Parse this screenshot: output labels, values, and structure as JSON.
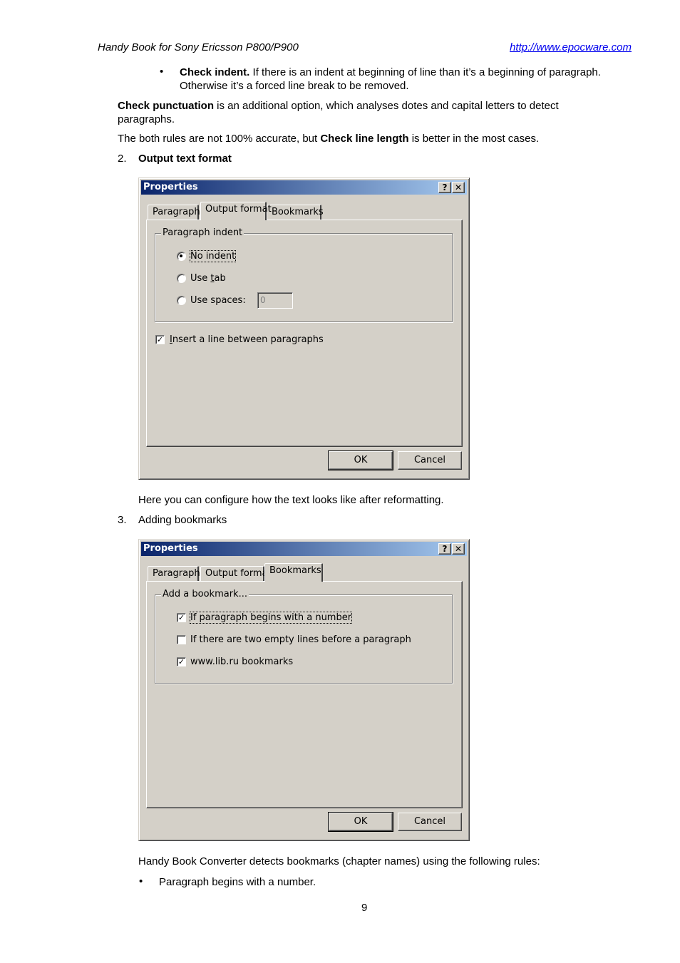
{
  "header": {
    "title": "Handy Book for Sony Ericsson P800/P900",
    "link": "http://www.epocware.com"
  },
  "text": {
    "bullet1_bold": "Check indent.",
    "bullet1_rest": " If there is an indent at beginning of line than it’s a beginning of paragraph.",
    "bullet1_line2": "Otherwise it’s a forced line break to be removed.",
    "p1_bold": "Check punctuation",
    "p1_rest": " is an additional option, which analyses dotes and capital letters to detect",
    "p1_line2": "paragraphs.",
    "p2_a": "The both rules are not 100% accurate, but ",
    "p2_bold": "Check line length",
    "p2_b": " is better in the most cases.",
    "item2_num": "2.",
    "item2_label": "Output text format",
    "after_dialog1": "Here you can configure how the text looks like after reformatting.",
    "item3_num": "3.",
    "item3_label": "Adding bookmarks",
    "after_dialog2": "Handy Book Converter detects bookmarks (chapter names) using the following rules:",
    "bullet_last": "Paragraph begins with a number.",
    "bullet_symbol": "•"
  },
  "dialog1": {
    "title": "Properties",
    "help_btn": "?",
    "close_btn": "✕",
    "tabs": [
      "Paragraph",
      "Output format",
      "Bookmarks"
    ],
    "active_tab": "Output format",
    "group_label": "Paragraph indent",
    "radio_no_indent": "No indent",
    "radio_use_tab_pre": "Use ",
    "radio_use_tab_u": "t",
    "radio_use_tab_post": "ab",
    "radio_use_spaces": "Use spaces:",
    "spaces_value": "0",
    "checkbox_insert_u": "I",
    "checkbox_insert_rest": "nsert a line between paragraphs",
    "check_mark": "✓",
    "ok": "OK",
    "cancel": "Cancel"
  },
  "dialog2": {
    "title": "Properties",
    "help_btn": "?",
    "close_btn": "✕",
    "tabs": [
      "Paragraph",
      "Output format",
      "Bookmarks"
    ],
    "active_tab": "Bookmarks",
    "group_label": "Add a bookmark...",
    "check1": "If paragraph begins with a number",
    "check2": "If there are two empty lines before a paragraph",
    "check3": "www.lib.ru bookmarks",
    "check_mark": "✓",
    "ok": "OK",
    "cancel": "Cancel"
  },
  "page_number": "9"
}
